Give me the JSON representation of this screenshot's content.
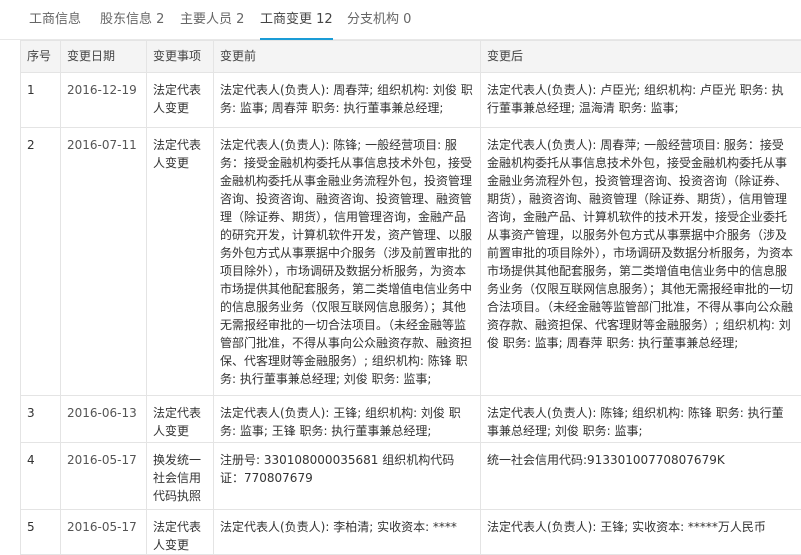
{
  "tabs": [
    {
      "label": "工商信息",
      "active": false
    },
    {
      "label": "股东信息 2",
      "active": false
    },
    {
      "label": "主要人员 2",
      "active": false
    },
    {
      "label": "工商变更 12",
      "active": true
    },
    {
      "label": "分支机构 0",
      "active": false
    }
  ],
  "table": {
    "headers": [
      "序号",
      "变更日期",
      "变更事项",
      "变更前",
      "变更后"
    ],
    "rows": [
      {
        "no": "1",
        "date": "2016-12-19",
        "item": "法定代表人变更",
        "before": "法定代表人(负责人): 周春萍; 组织机构: 刘俊 职务: 监事; 周春萍 职务: 执行董事兼总经理;",
        "after": "法定代表人(负责人): 卢臣光; 组织机构: 卢臣光 职务: 执行董事兼总经理; 温海清 职务: 监事;"
      },
      {
        "no": "2",
        "date": "2016-07-11",
        "item": "法定代表人变更",
        "before": "法定代表人(负责人): 陈锋; 一般经营项目: 服务：接受金融机构委托从事信息技术外包，接受金融机构委托从事金融业务流程外包，投资管理咨询、投资咨询、融资咨询、投资管理、融资管理（除证券、期货），信用管理咨询，金融产品的研究开发，计算机软件开发，资产管理、以服务外包方式从事票据中介服务（涉及前置审批的项目除外），市场调研及数据分析服务，为资本市场提供其他配套服务，第二类增值电信业务中的信息服务业务（仅限互联网信息服务）；其他无需报经审批的一切合法项目。（未经金融等监管部门批准，不得从事向公众融资存款、融资担保、代客理财等金融服务）; 组织机构: 陈锋 职务: 执行董事兼总经理; 刘俊 职务: 监事;",
        "after": "法定代表人(负责人): 周春萍; 一般经营项目: 服务：接受金融机构委托从事信息技术外包，接受金融机构委托从事金融业务流程外包，投资管理咨询、投资咨询（除证券、期货），融资咨询、融资管理（除证券、期货），信用管理咨询，金融产品、计算机软件的技术开发，接受企业委托从事资产管理，以服务外包方式从事票据中介服务（涉及前置审批的项目除外），市场调研及数据分析服务，为资本市场提供其他配套服务，第二类增值电信业务中的信息服务业务（仅限互联网信息服务）；其他无需报经审批的一切合法项目。（未经金融等监管部门批准，不得从事向公众融资存款、融资担保、代客理财等金融服务）; 组织机构: 刘俊 职务: 监事; 周春萍 职务: 执行董事兼总经理;"
      },
      {
        "no": "3",
        "date": "2016-06-13",
        "item": "法定代表人变更",
        "before": "法定代表人(负责人): 王锋; 组织机构: 刘俊 职务: 监事; 王锋 职务: 执行董事兼总经理;",
        "after": "法定代表人(负责人): 陈锋; 组织机构: 陈锋 职务: 执行董事兼总经理; 刘俊 职务: 监事;"
      },
      {
        "no": "4",
        "date": "2016-05-17",
        "item": "换发统一社会信用代码执照",
        "before": "注册号: 330108000035681 组织机构代码证：770807679",
        "after": "统一社会信用代码:91330100770807679K"
      },
      {
        "no": "5",
        "date": "2016-05-17",
        "item": "法定代表人变更",
        "before": "法定代表人(负责人): 李柏清; 实收资本: ****",
        "after": "法定代表人(负责人): 王锋; 实收资本: *****万人民币"
      }
    ]
  }
}
